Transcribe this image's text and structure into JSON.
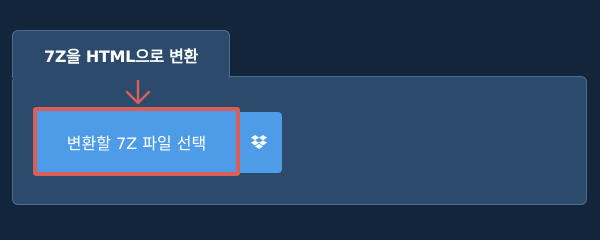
{
  "converter": {
    "tab_title": "7Z을 HTML으로 변환",
    "choose_file_label": "변환할 7Z 파일 선택",
    "dropbox_icon": "dropbox-icon",
    "pointer_icon": "arrow-down-icon"
  },
  "colors": {
    "background": "#13253a",
    "panel": "#2b4a6c",
    "button": "#4e9ce8",
    "highlight": "#d9605a"
  }
}
